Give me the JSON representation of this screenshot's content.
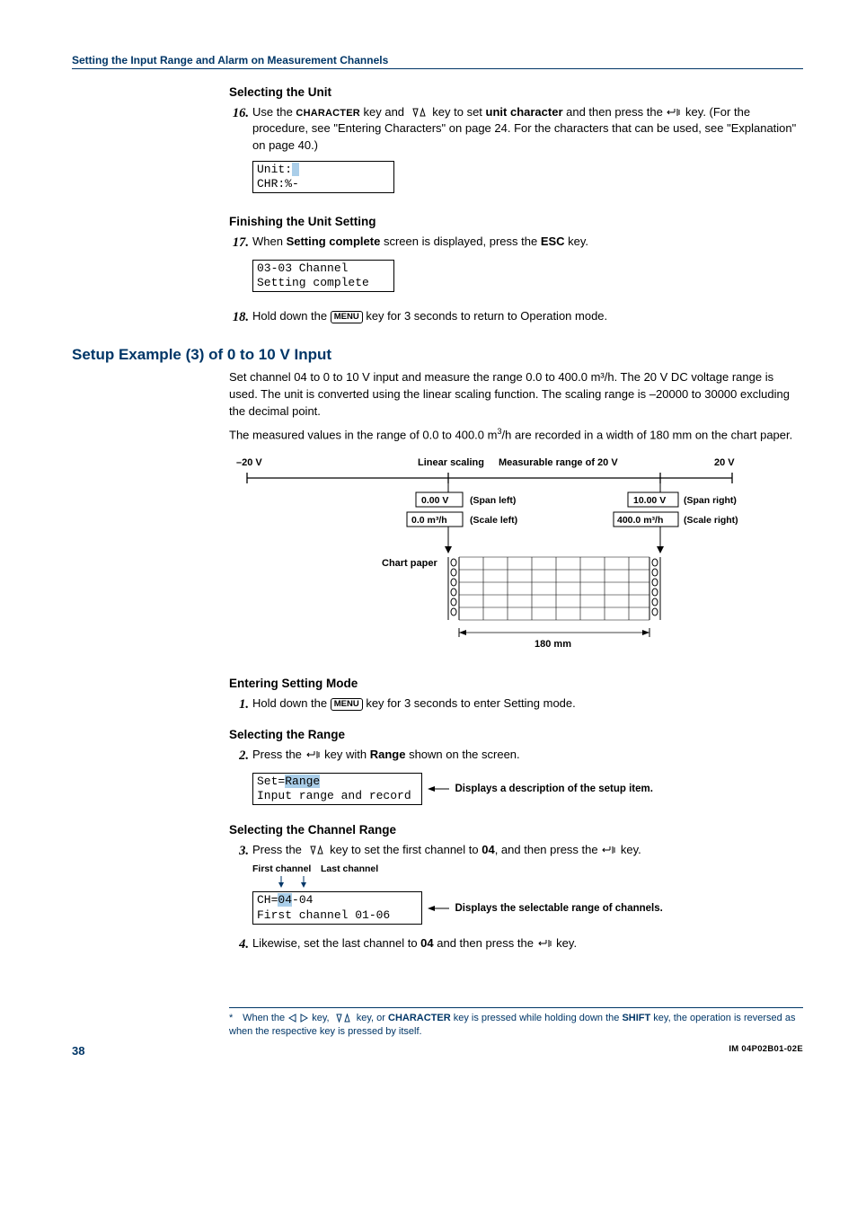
{
  "header": "Setting the Input Range and Alarm on Measurement Channels",
  "sec_unit": {
    "title": "Selecting the Unit",
    "step16_num": "16.",
    "step16_a": "Use the ",
    "step16_char": "CHARACTER",
    "step16_b": " key and ",
    "step16_c": " key to set ",
    "step16_bold": "unit character",
    "step16_d": " and then press the ",
    "step16_e": " key. (For the procedure, see \"Entering Characters\" on page 24. For the characters that can be used, see \"Explanation\" on page 40.)",
    "lcd16_l1a": "Unit:",
    "lcd16_l1b": " ",
    "lcd16_l2": "CHR:%-"
  },
  "sec_finish": {
    "title": "Finishing the Unit Setting",
    "step17_num": "17.",
    "step17_a": "When ",
    "step17_bold": "Setting complete",
    "step17_b": " screen is displayed, press the ",
    "step17_esc": "ESC",
    "step17_c": " key.",
    "lcd17_l1": "03-03 Channel",
    "lcd17_l2": "Setting complete",
    "step18_num": "18.",
    "step18_a": "Hold down the ",
    "step18_b": " key for 3 seconds to return to Operation mode."
  },
  "sec_setup3": {
    "title": "Setup Example (3) of 0 to 10 V Input",
    "p1": "Set channel 04 to 0 to 10 V input and measure the range 0.0 to 400.0 m³/h. The 20 V DC voltage range is used. The unit is converted using the linear scaling function. The scaling range is –20000 to 30000 excluding the decimal point.",
    "p2a": "The measured values in the range of 0.0 to 400.0 m",
    "p2s": "3",
    "p2b": "/h are recorded in a width of 180 mm on the chart paper."
  },
  "diagram": {
    "neg20v": "–20 V",
    "linscale": "Linear scaling",
    "measrange": "Measurable range of 20 V",
    "pos20v": "20 V",
    "spanl_val": "0.00 V",
    "spanl_lbl": "(Span left)",
    "spanr_val": "10.00 V",
    "spanr_lbl": "(Span right)",
    "scalel_val": "0.0 m³/h",
    "scalel_lbl": "(Scale left)",
    "scaler_val": "400.0 m³/h",
    "scaler_lbl": "(Scale right)",
    "chartpaper": "Chart paper",
    "w180": "180 mm"
  },
  "sec_enter": {
    "title": "Entering Setting Mode",
    "step1_num": "1.",
    "step1_a": "Hold down the ",
    "step1_b": " key for 3 seconds to enter Setting mode."
  },
  "sec_range": {
    "title": "Selecting the Range",
    "step2_num": "2.",
    "step2_a": "Press the ",
    "step2_b": " key with ",
    "step2_bold": "Range",
    "step2_c": " shown on the screen.",
    "lcd2_l1a": "Set=",
    "lcd2_l1b": "Range",
    "lcd2_l2": "Input range and record",
    "callout2": "Displays a description of the setup item."
  },
  "sec_chrange": {
    "title": "Selecting the Channel Range",
    "step3_num": "3.",
    "step3_a": "Press the ",
    "step3_b": " key to set the first channel to ",
    "step3_bold": "04",
    "step3_c": ", and then press the ",
    "step3_d": " key.",
    "first_ch": "First channel",
    "last_ch": "Last channel",
    "lcd3_l1a": "CH=",
    "lcd3_l1b": "04",
    "lcd3_l1c": "-04",
    "lcd3_l2": "First channel 01-06",
    "callout3": "Displays the selectable range of channels.",
    "step4_num": "4.",
    "step4_a": "Likewise, set the last channel to ",
    "step4_bold": "04",
    "step4_b": " and then press the ",
    "step4_c": " key."
  },
  "footnote": {
    "star": "*",
    "a": "When the ",
    "b": " key, ",
    "c": " key, or ",
    "char": "CHARACTER",
    "d": " key is pressed while holding down the ",
    "shift": "SHIFT",
    "e": " key, the operation is reversed as when the respective key is pressed by itself."
  },
  "footer": {
    "page": "38",
    "doc": "IM 04P02B01-02E"
  },
  "keys": {
    "menu": "MENU"
  }
}
